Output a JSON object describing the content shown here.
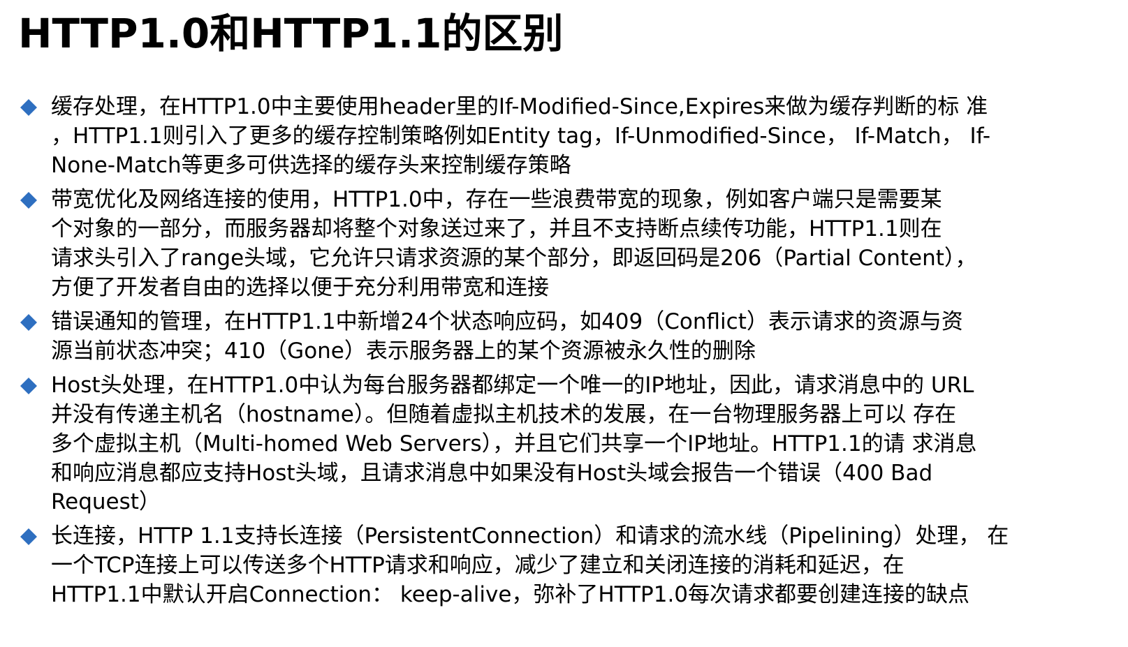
{
  "title": "HTTP1.0和HTTP1.1的区别",
  "colors": {
    "bullet": "#2e6fc0",
    "text": "#000000",
    "background": "#ffffff"
  },
  "items": [
    {
      "lines": [
        "缓存处理，在HTTP1.0中主要使用header里的If-Modified-Since,Expires来做为缓存判断的标  准",
        "，HTTP1.1则引入了更多的缓存控制策略例如Entity  tag，If-Unmodified-Since， If-Match，   If-",
        "None-Match等更多可供选择的缓存头来控制缓存策略"
      ]
    },
    {
      "lines": [
        "带宽优化及网络连接的使用，HTTP1.0中，存在一些浪费带宽的现象，例如客户端只是需要某",
        "个对象的一部分，而服务器却将整个对象送过来了，并且不支持断点续传功能，HTTP1.1则在",
        "请求头引入了range头域，它允许只请求资源的某个部分，即返回码是206（Partial Content），",
        "方便了开发者自由的选择以便于充分利用带宽和连接"
      ]
    },
    {
      "lines": [
        "错误通知的管理，在HTTP1.1中新增24个状态响应码，如409（Conflict）表示请求的资源与资",
        "源当前状态冲突；410（Gone）表示服务器上的某个资源被永久性的删除"
      ]
    },
    {
      "lines": [
        "Host头处理，在HTTP1.0中认为每台服务器都绑定一个唯一的IP地址，因此，请求消息中的 URL",
        "并没有传递主机名（hostname）。但随着虚拟主机技术的发展，在一台物理服务器上可以 存在",
        "多个虚拟主机（Multi-homed Web Servers），并且它们共享一个IP地址。HTTP1.1的请 求消息",
        "和响应消息都应支持Host头域，且请求消息中如果没有Host头域会报告一个错误（400  Bad",
        "Request）"
      ]
    },
    {
      "lines": [
        "长连接，HTTP 1.1支持长连接（PersistentConnection）和请求的流水线（Pipelining）处理，  在",
        "一个TCP连接上可以传送多个HTTP请求和响应，减少了建立和关闭连接的消耗和延迟，在",
        "HTTP1.1中默认开启Connection： keep-alive，弥补了HTTP1.0每次请求都要创建连接的缺点"
      ]
    }
  ]
}
